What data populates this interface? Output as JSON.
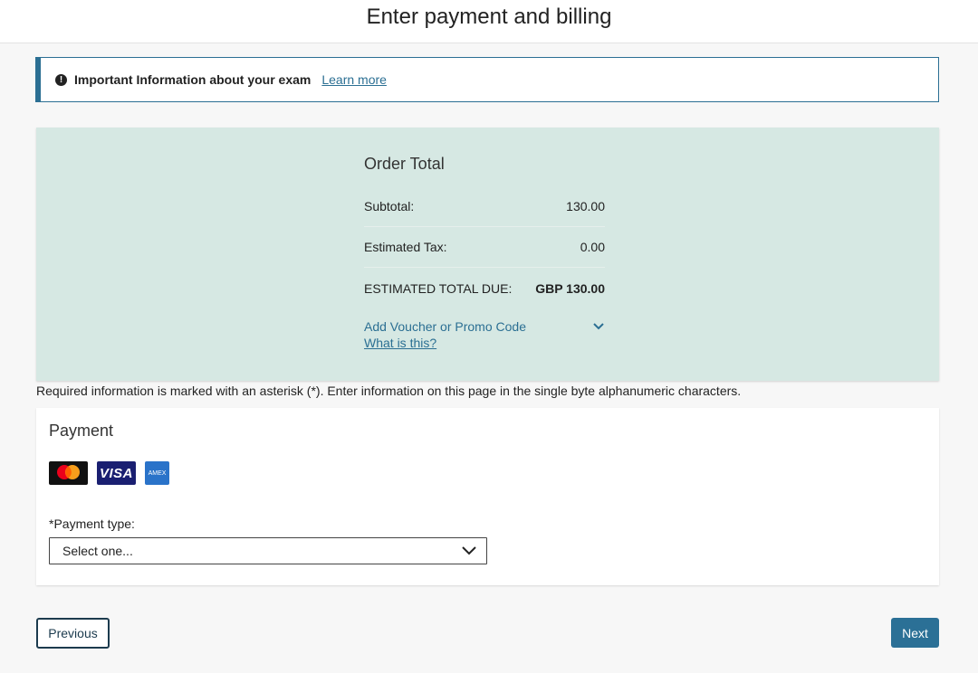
{
  "header": {
    "title": "Enter payment and billing"
  },
  "alert": {
    "icon": "info-icon",
    "text": "Important Information about your exam",
    "link_label": "Learn more"
  },
  "order": {
    "title": "Order Total",
    "rows": [
      {
        "label": "Subtotal:",
        "value": "130.00"
      },
      {
        "label": "Estimated Tax:",
        "value": "0.00"
      },
      {
        "label": "ESTIMATED TOTAL DUE:",
        "value": "GBP 130.00"
      }
    ],
    "voucher_label": "Add Voucher or Promo Code",
    "whatis_label": "What is this?"
  },
  "required_note": "Required information is marked with an asterisk (*). Enter information on this page in the single byte alphanumeric characters.",
  "payment": {
    "title": "Payment",
    "logos": {
      "mastercard": "mastercard",
      "visa": "VISA",
      "amex": "AMEX"
    },
    "type_label": "*Payment type:",
    "type_selected": "Select one..."
  },
  "buttons": {
    "previous": "Previous",
    "next": "Next"
  },
  "colors": {
    "accent": "#2b6f93",
    "order_panel_bg": "#d6e8e3",
    "next_button_bg": "#2b7096"
  }
}
